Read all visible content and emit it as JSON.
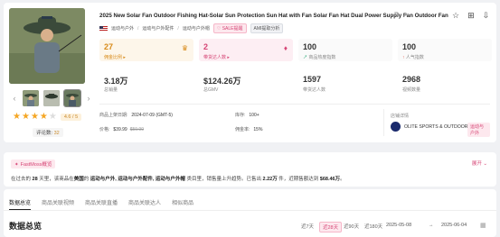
{
  "product": {
    "title": "2025 New Solar Fan Outdoor Fishing Hat-Solar Sun Protection Sun Hat with Fan Solar Fan Hat Dual Power Supply Fan Outdoor Fan",
    "rating": "4.6 / 5",
    "rating_stars": 4.6,
    "reviews_label": "评论数:",
    "reviews_count": "32"
  },
  "categories": [
    "运动与户外",
    "运动与户外配件",
    "运动与户外帽"
  ],
  "tags": {
    "sale": "♡ SALE提醒",
    "ai": "AMI提取分析"
  },
  "stats": [
    {
      "value": "27",
      "label": "佣金比例 ▸"
    },
    {
      "value": "2",
      "label": "带货达人数 ▸"
    },
    {
      "value": "100",
      "label": "商品热度指数",
      "arrow": "↗"
    },
    {
      "value": "100",
      "label": "人气指数",
      "arrow": "↑"
    },
    {
      "value": "3.18万",
      "label": "总销量"
    },
    {
      "value": "$124.26万",
      "label": "总GMV"
    },
    {
      "value": "1597",
      "label": "带货达人数"
    },
    {
      "value": "2968",
      "label": "视频数量"
    }
  ],
  "info": {
    "launch_label": "商品上架日期:",
    "launch_value": "2024-07-09 (GMT-5)",
    "price_label": "价格:",
    "price_value": "$39.99",
    "price_orig": "$59.99",
    "stock_label": "库存:",
    "stock_value": "100+",
    "commission_label": "佣金率:",
    "commission_value": "15%"
  },
  "store": {
    "label": "店铺详情",
    "name": "OLITE SPORTS & OUTDOOR",
    "tag": "运动与户外"
  },
  "fastmoss": {
    "badge": "FastMoss概览",
    "expand": "展开 ⌄",
    "text_1": "在过去的",
    "days": "28",
    "text_2": "天里，该商品在",
    "country": "美国",
    "text_3": "的",
    "cat_path": "运动与户外, 运动与户外配件, 运动与户外帽",
    "text_4": "类目里，销售量上升趋势。已售出",
    "sold": "2.22万",
    "text_5": "件，近期售额达到",
    "gmv": "$68.46万",
    "text_6": "。"
  },
  "tabs": [
    "数据总览",
    "商品关联视频",
    "商品关联直播",
    "商品关联达人",
    "相似商品"
  ],
  "section_title": "数据总览",
  "ranges": [
    "近7天",
    "近28天",
    "近90天",
    "近180天"
  ],
  "date_start": "2025-05-08",
  "date_sep": "→",
  "date_end": "2025-06-04",
  "colors": {
    "accent": "#d64575",
    "orange": "#d88b1a"
  }
}
